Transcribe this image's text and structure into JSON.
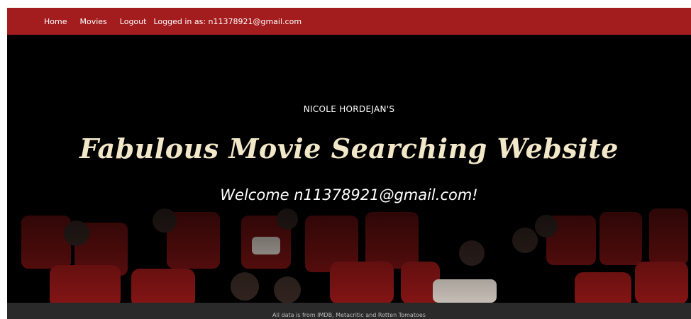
{
  "nav": {
    "home": "Home",
    "movies": "Movies",
    "logout": "Logout",
    "logged_in": "Logged in as: n11378921@gmail.com"
  },
  "hero": {
    "eyebrow": "NICOLE HORDEJAN'S",
    "headline": "Fabulous Movie Searching Website",
    "welcome": "Welcome n11378921@gmail.com!"
  },
  "footer": {
    "text": "All data is from IMDB, Metacritic and Rotten Tomatoes"
  },
  "colors": {
    "navbar": "#a31d1e",
    "headline": "#f2e7c8",
    "seat": "#8a1414",
    "footer": "#2a2a2a"
  }
}
